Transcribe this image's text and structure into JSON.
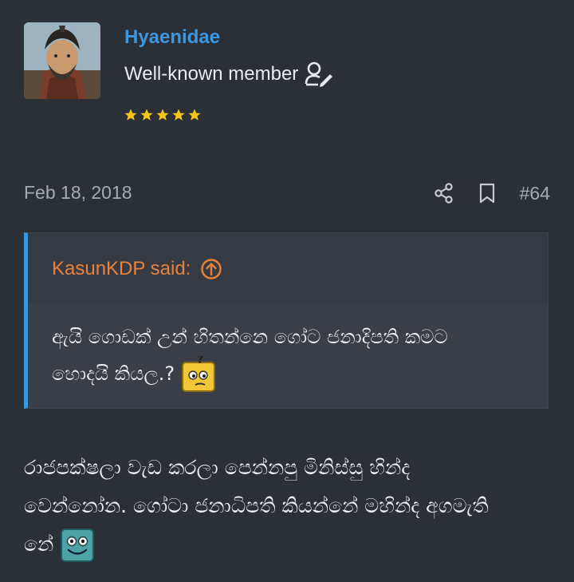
{
  "user": {
    "name": "Hyaenidae",
    "title": "Well-known member",
    "avatar_icon": "avatar-portrait",
    "title_badge_icon": "user-edit-icon",
    "star_count": 5,
    "star_color": "#f5c518"
  },
  "post": {
    "date": "Feb 18, 2018",
    "number": "#64",
    "action_icons": [
      "share-icon",
      "bookmark-icon"
    ]
  },
  "quote": {
    "author_said": "KasunKDP said:",
    "line1": "ඇයි ගොඩක් උන් හිතන්නෙ ගෝට ජනාදිපති කමට",
    "line2": "හොදයි කියල.?"
  },
  "message": {
    "line1": "රාජපක්ෂලා වැඩ කරලා පෙන්නපු මිනිස්සු හින්ද",
    "line2": "වෙන්නෝන. ගෝටා ජනාධිපති කියන්නේ මහින්ද අගමැති",
    "line3": "නේ"
  },
  "colors": {
    "background": "#2b2f36",
    "username": "#3b97e0",
    "quote_author": "#e8823a",
    "quote_border": "#3b97e0"
  }
}
